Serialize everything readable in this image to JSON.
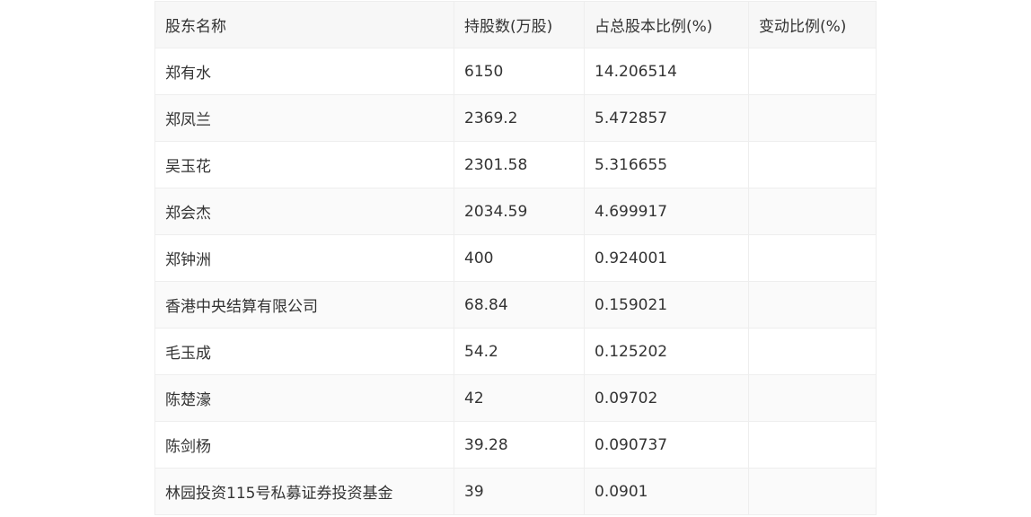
{
  "table": {
    "headers": [
      "股东名称",
      "持股数(万股)",
      "占总股本比例(%)",
      "变动比例(%)"
    ],
    "rows": [
      [
        "郑有水",
        "6150",
        "14.206514",
        ""
      ],
      [
        "郑凤兰",
        "2369.2",
        "5.472857",
        ""
      ],
      [
        "吴玉花",
        "2301.58",
        "5.316655",
        ""
      ],
      [
        "郑会杰",
        "2034.59",
        "4.699917",
        ""
      ],
      [
        "郑钟洲",
        "400",
        "0.924001",
        ""
      ],
      [
        "香港中央结算有限公司",
        "68.84",
        "0.159021",
        ""
      ],
      [
        "毛玉成",
        "54.2",
        "0.125202",
        ""
      ],
      [
        "陈楚濠",
        "42",
        "0.09702",
        ""
      ],
      [
        "陈剑杨",
        "39.28",
        "0.090737",
        ""
      ],
      [
        "林园投资115号私募证券投资基金",
        "39",
        "0.0901",
        ""
      ]
    ]
  }
}
